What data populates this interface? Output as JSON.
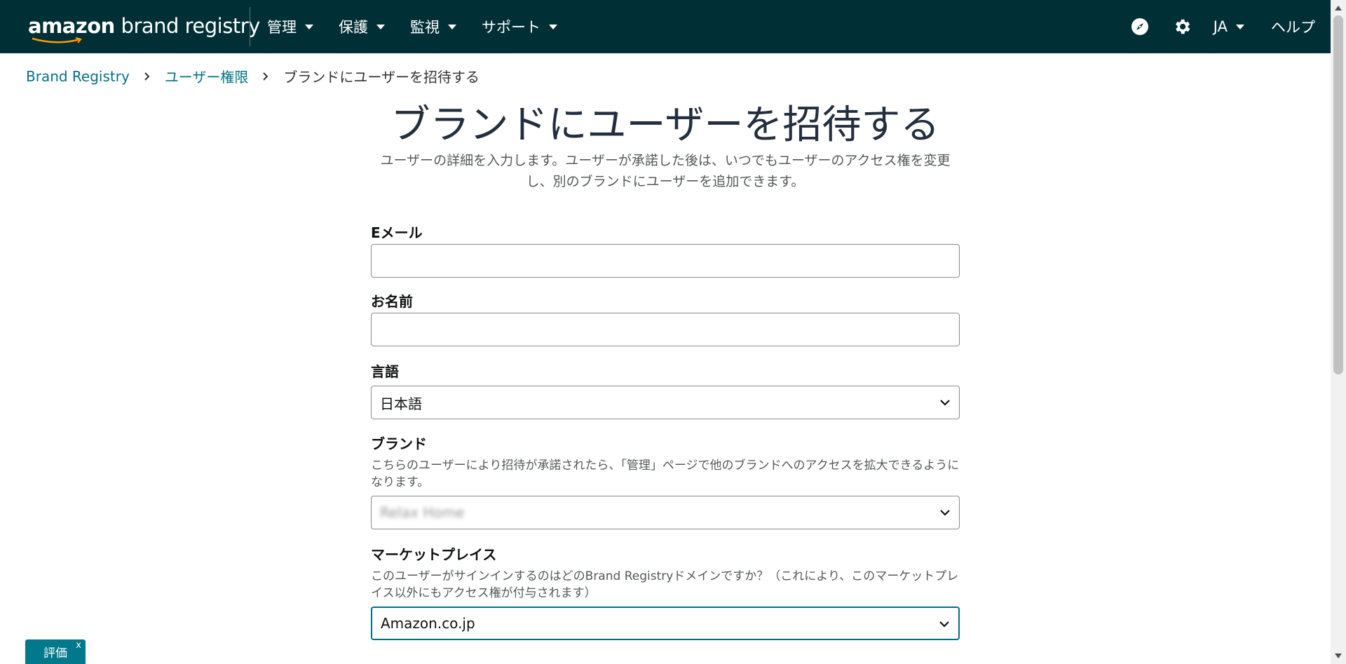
{
  "header": {
    "logo_prefix": "amazon",
    "logo_suffix": " brand registry",
    "nav": [
      {
        "label": "管理"
      },
      {
        "label": "保護"
      },
      {
        "label": "監視"
      },
      {
        "label": "サポート"
      }
    ],
    "language": "JA",
    "help": "ヘルプ",
    "icons": [
      "compass-icon",
      "gear-icon"
    ]
  },
  "breadcrumb": {
    "items": [
      "Brand Registry",
      "ユーザー権限"
    ],
    "current": "ブランドにユーザーを招待する"
  },
  "page": {
    "title": "ブランドにユーザーを招待する",
    "subtitle": "ユーザーの詳細を入力します。ユーザーが承諾した後は、いつでもユーザーのアクセス権を変更し、別のブランドにユーザーを追加できます。"
  },
  "form": {
    "email": {
      "label": "Eメール",
      "value": ""
    },
    "name": {
      "label": "お名前",
      "value": ""
    },
    "language": {
      "label": "言語",
      "value": "日本語"
    },
    "brand": {
      "label": "ブランド",
      "help": "こちらのユーザーにより招待が承諾されたら、「管理」ページで他のブランドへのアクセスを拡大できるようになります。",
      "value": "Relax Home"
    },
    "marketplace": {
      "label": "マーケットプレイス",
      "help": "このユーザーがサインインするのはどのBrand Registryドメインですか？（これにより、このマーケットプレイス以外にもアクセス権が付与されます）",
      "value": "Amazon.co.jp"
    }
  },
  "feedback": {
    "label": "評価",
    "close": "x"
  },
  "colors": {
    "header_bg": "#002f36",
    "link": "#007185",
    "feedback_bg": "#00798c"
  }
}
